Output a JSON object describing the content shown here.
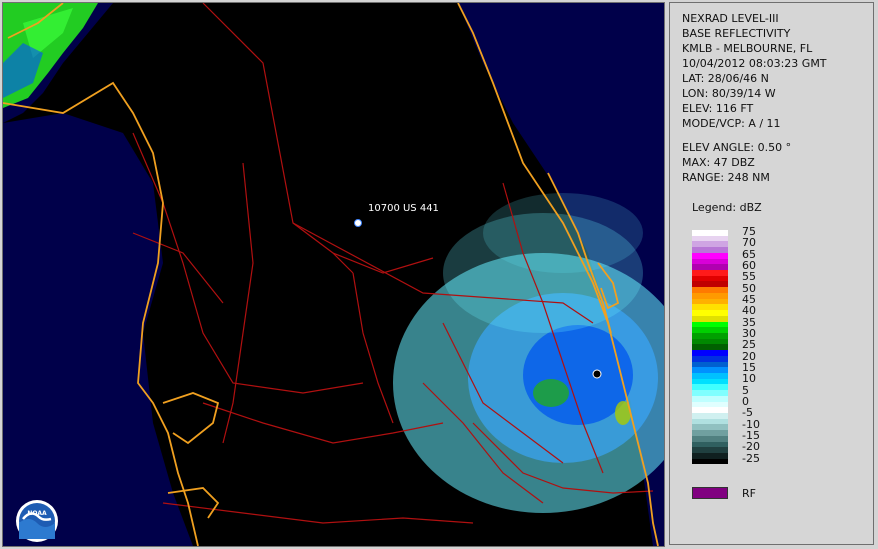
{
  "header": {
    "product": "NEXRAD LEVEL-III",
    "product_type": "BASE REFLECTIVITY",
    "station": "KMLB - MELBOURNE, FL",
    "datetime": "10/04/2012 08:03:23 GMT",
    "lat": "LAT: 28/06/46 N",
    "lon": "LON: 80/39/14 W",
    "elev": "ELEV: 116 FT",
    "mode": "MODE/VCP: A / 11",
    "elev_angle": "ELEV ANGLE: 0.50 °",
    "max": "MAX: 47 DBZ",
    "range": "RANGE: 248 NM"
  },
  "legend": {
    "title": "Legend: dBZ",
    "ticks": [
      "75",
      "70",
      "65",
      "60",
      "55",
      "50",
      "45",
      "40",
      "35",
      "30",
      "25",
      "20",
      "15",
      "10",
      "5",
      "0",
      "-5",
      "-10",
      "-15",
      "-20",
      "-25"
    ],
    "colors": [
      "#ffffff",
      "#e7d3f0",
      "#cfa5e3",
      "#b777d6",
      "#ff00ff",
      "#d800d8",
      "#b000b0",
      "#ff1a1a",
      "#e00000",
      "#c00000",
      "#ff7a00",
      "#ff9a00",
      "#ffb000",
      "#ffe000",
      "#ffff00",
      "#e0e000",
      "#00ff00",
      "#00d000",
      "#00a000",
      "#008800",
      "#006000",
      "#0000ff",
      "#0030e0",
      "#0060d0",
      "#0090ff",
      "#00c0ff",
      "#00e0ff",
      "#40ffff",
      "#80ffff",
      "#bfffff",
      "#e0ffff",
      "#ffffff",
      "#d0f0f0",
      "#b0e0e0",
      "#90c0c0",
      "#70a0a0",
      "#508080",
      "#306060",
      "#204040",
      "#102020",
      "#000000"
    ],
    "rf_label": "RF"
  },
  "map": {
    "marker_label": "10700 US 441",
    "colors": {
      "background": "#000000",
      "ocean": "#00004a",
      "coast": "#f0a020",
      "roads": "#b01010",
      "echo_light": "#66eeff",
      "echo_mid": "#0070ff",
      "echo_green": "#22aa22"
    }
  },
  "logo": {
    "text": "NOAA"
  }
}
